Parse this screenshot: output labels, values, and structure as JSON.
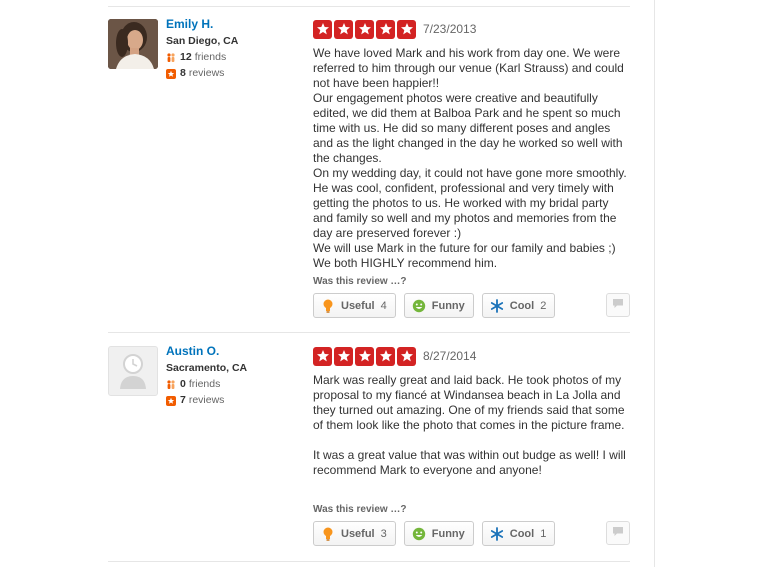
{
  "reviews": [
    {
      "user": {
        "name": "Emily H.",
        "location": "San Diego, CA",
        "friends_count": "12",
        "friends_label": "friends",
        "reviews_count": "8",
        "reviews_label": "reviews"
      },
      "rating": 5,
      "date": "7/23/2013",
      "paragraphs": [
        "We have loved Mark and his work from day one. We were referred to him through our venue (Karl Strauss) and could not have been happier!!",
        "Our engagement photos were creative and beautifully edited, we did them at Balboa Park and he spent so much time with us. He did so many different poses and angles and as the light changed in the day he worked so well with the changes.",
        "On my wedding day, it could not have gone more smoothly. He was cool, confident, professional and very timely with getting the photos to us. He worked with my bridal party and family so well and my photos and memories from the day are preserved forever :)",
        "We will use Mark in the future for our family and babies ;)",
        "We both HIGHLY recommend him."
      ],
      "was_review_label": "Was this review …?",
      "votes": {
        "useful_label": "Useful",
        "useful_count": "4",
        "funny_label": "Funny",
        "funny_count": "",
        "cool_label": "Cool",
        "cool_count": "2"
      }
    },
    {
      "user": {
        "name": "Austin O.",
        "location": "Sacramento, CA",
        "friends_count": "0",
        "friends_label": "friends",
        "reviews_count": "7",
        "reviews_label": "reviews"
      },
      "rating": 5,
      "date": "8/27/2014",
      "paragraphs": [
        "Mark was really great and laid back.  He took photos of my proposal to my fiancé at Windansea beach in La Jolla and they turned out amazing.  One of my friends said that some of them look like the photo that comes in the picture frame.",
        "",
        "It was a great value that was within out budge as well!  I will recommend Mark to everyone and anyone!"
      ],
      "was_review_label": "Was this review …?",
      "votes": {
        "useful_label": "Useful",
        "useful_count": "3",
        "funny_label": "Funny",
        "funny_count": "",
        "cool_label": "Cool",
        "cool_count": "1"
      }
    }
  ],
  "colors": {
    "star_red": "#d32323",
    "link_blue": "#0073bb",
    "friends_orange": "#f15c00",
    "useful_orange": "#f8951d",
    "funny_green": "#74b63b",
    "cool_blue": "#1c73b9"
  },
  "icons": [
    "friends-icon",
    "reviews-icon",
    "star-icon",
    "useful-bulb-icon",
    "funny-smiley-icon",
    "cool-snowflake-icon",
    "comment-icon",
    "default-avatar-icon"
  ]
}
